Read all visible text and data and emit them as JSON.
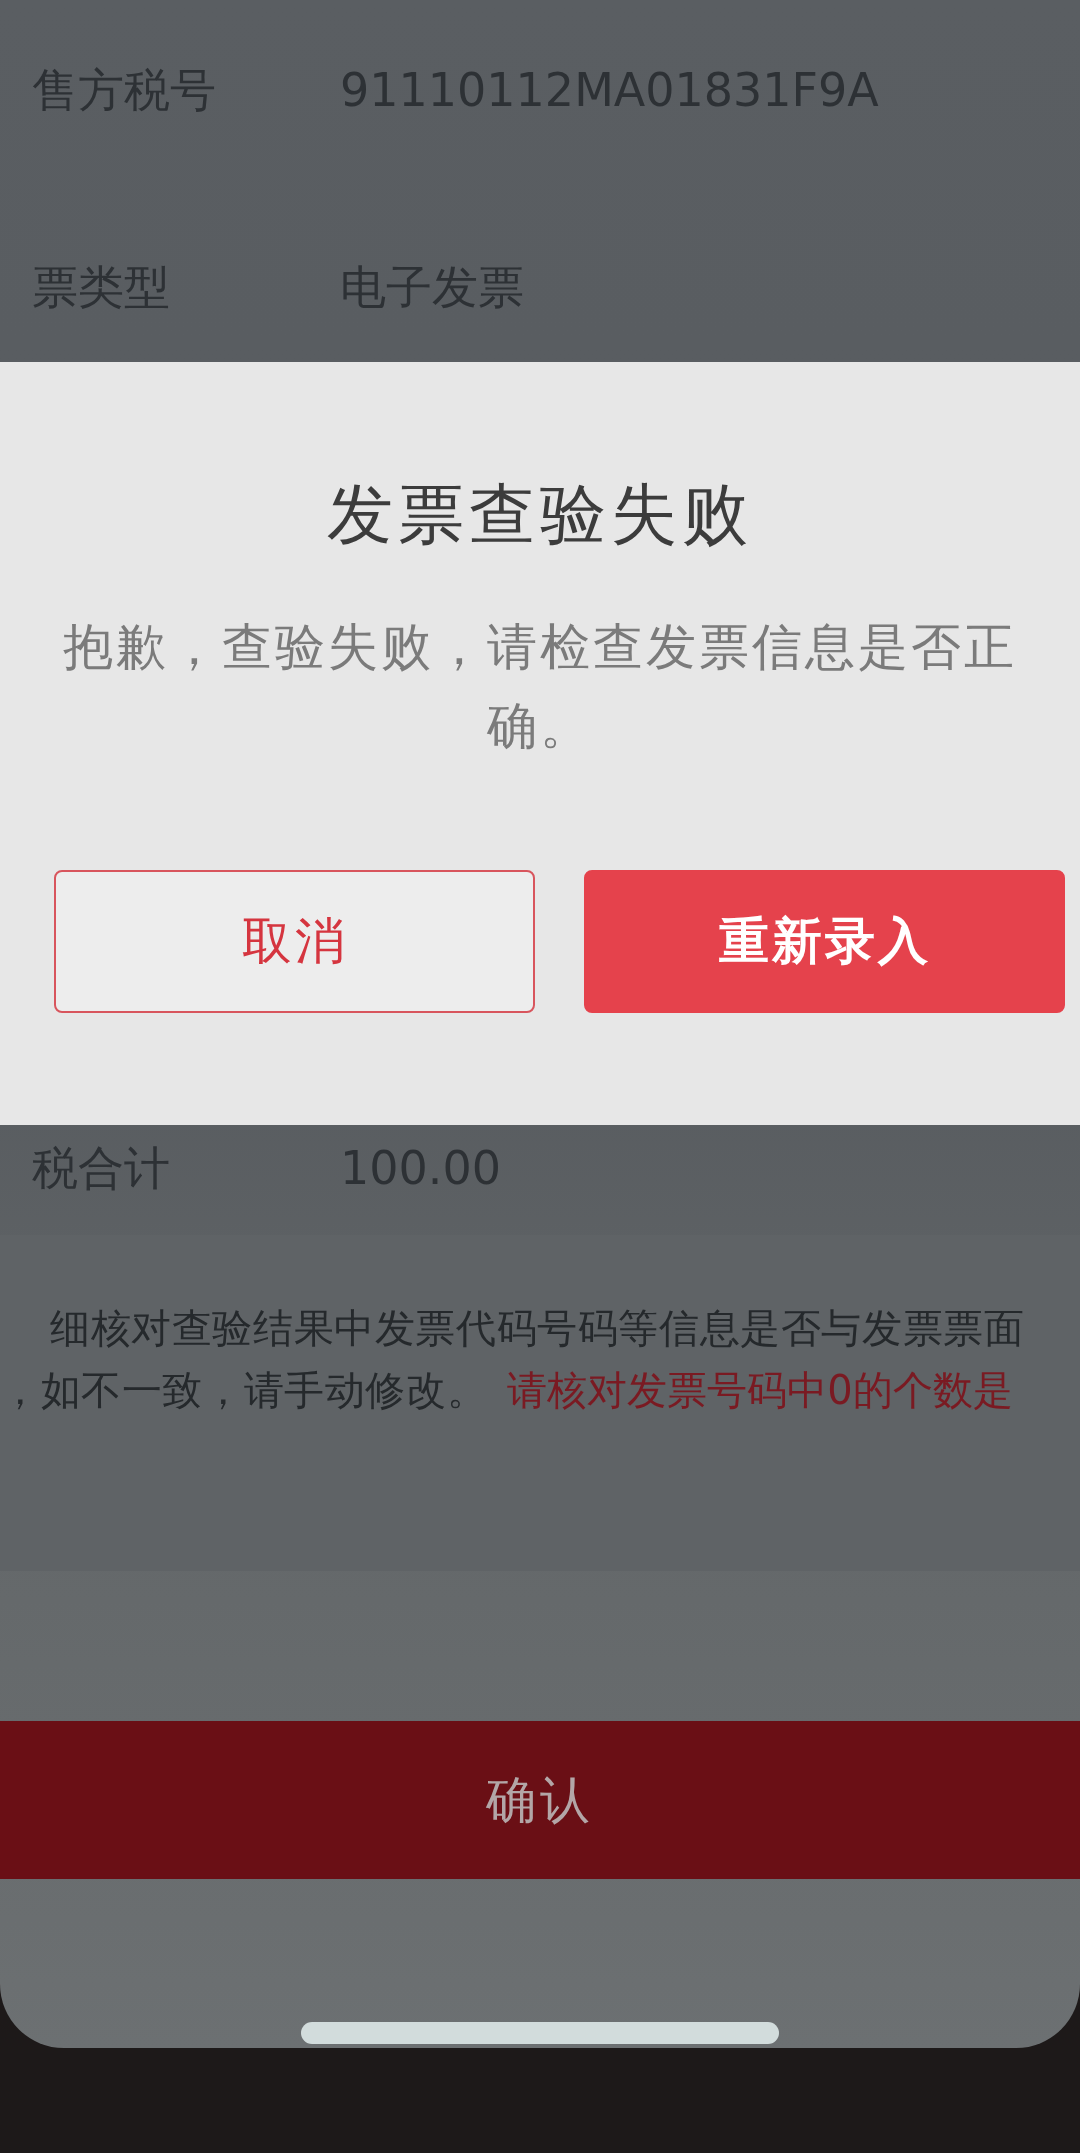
{
  "background_page": {
    "rows": [
      {
        "label": "售方税号",
        "value": "91110112MA01831F9A"
      },
      {
        "label": "票类型",
        "value": "电子发票"
      }
    ],
    "total_row": {
      "label": "税合计",
      "value": "100.00"
    },
    "notice": {
      "line_1": "细核对查验结果中发票代码号码等信息是否与发票票面",
      "line_2": "，如不一致，请手动修改。",
      "warning": "请核对发票号码中0的个数是"
    },
    "confirm_button": {
      "label": "确认"
    }
  },
  "dialog": {
    "title": "发票查验失败",
    "message": "抱歉，查验失败，请检查发票信息是否正确。",
    "buttons": [
      {
        "label": "取消",
        "kind": "secondary"
      },
      {
        "label": "重新录入",
        "kind": "primary"
      }
    ]
  }
}
